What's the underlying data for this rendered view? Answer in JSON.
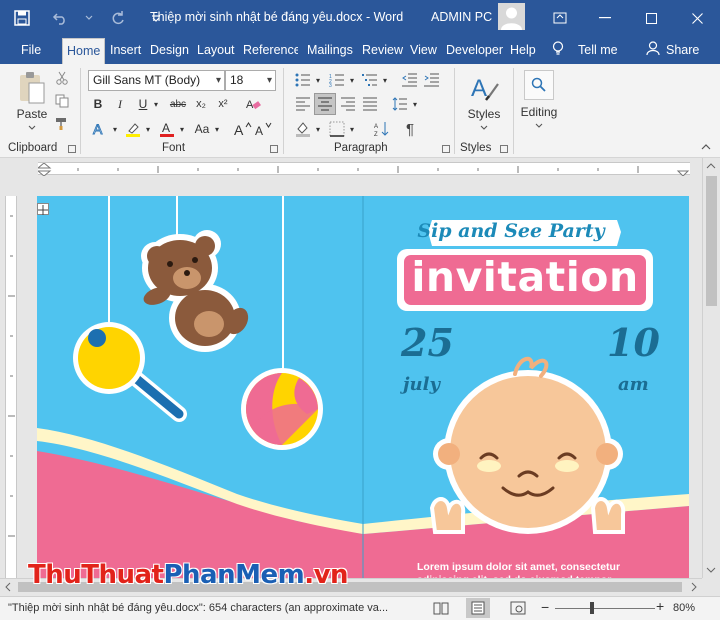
{
  "window": {
    "doc_title": "Thiệp mời sinh nhật bé đáng yêu.docx  -  Word",
    "user_name": "ADMIN PC"
  },
  "tabs": [
    "File",
    "Home",
    "Insert",
    "Design",
    "Layout",
    "References",
    "Mailings",
    "Review",
    "View",
    "Developer",
    "Help"
  ],
  "tell_me": "Tell me",
  "share": "Share",
  "ribbon": {
    "paste_label": "Paste",
    "font_name": "Gill Sans MT (Body)",
    "font_size": "18",
    "aa_label": "Aa",
    "groups": {
      "clipboard": "Clipboard",
      "font": "Font",
      "paragraph": "Paragraph",
      "styles": "Styles"
    },
    "styles_label": "Styles",
    "editing_label": "Editing"
  },
  "card": {
    "tagline": "Sip and See Party",
    "title": "invitation",
    "day": "25",
    "month": "july",
    "hour": "10",
    "ampm": "am",
    "body_line1": "Lorem ipsum dolor sit amet, consectetur",
    "body_line2": "adipiscing elit, sed do eiusmod tempor"
  },
  "status": {
    "text": "\"Thiệp mời sinh nhật bé đáng yêu.docx\": 654 characters (an approximate va...",
    "zoom": "80%"
  },
  "watermark": {
    "part1": "ThuThuat",
    "part2": "PhanMem",
    "part3": ".vn"
  },
  "colors": {
    "word_blue": "#2b579a",
    "sky": "#4fc3ef",
    "pink": "#ef6b93",
    "cream": "#fff6c8"
  }
}
